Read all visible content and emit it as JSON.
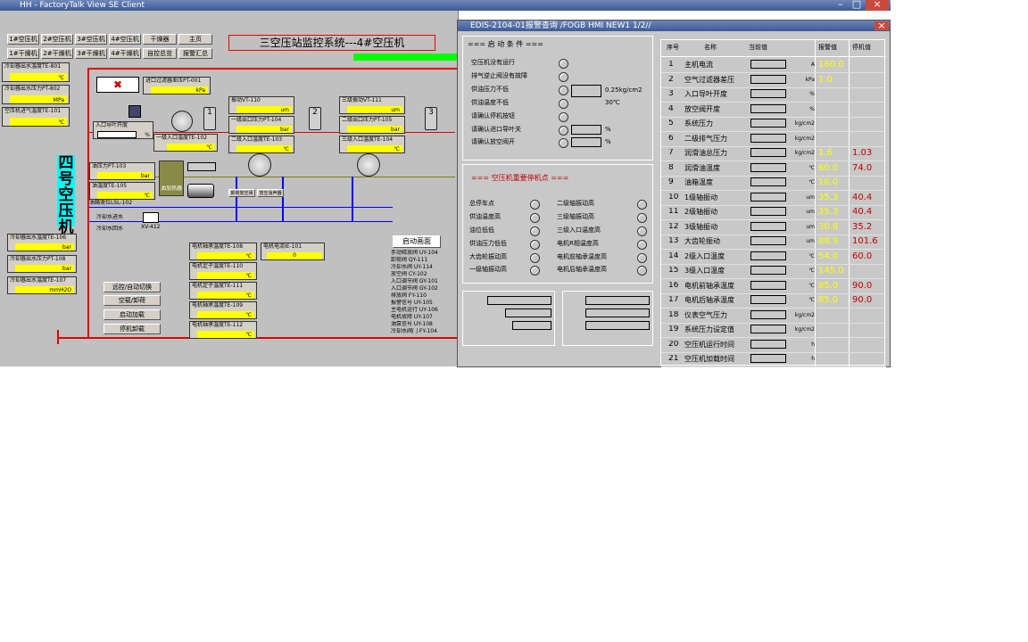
{
  "window": {
    "title": "HH - FactoryTalk View SE Client"
  },
  "scada": {
    "title": "三空压站监控系统---4#空压机",
    "nav_buttons_row1": [
      "1#空压机",
      "2#空压机",
      "3#空压机",
      "4#空压机",
      "干燥器",
      "主页"
    ],
    "nav_buttons_row2": [
      "1#干燥机",
      "2#干燥机",
      "3#干燥机",
      "4#干燥机",
      "自控总览",
      "报警汇总"
    ],
    "left_tags": [
      {
        "label": "冷却器出水温度TE-801",
        "unit": "℃"
      },
      {
        "label": "冷却器出水压力PT-802",
        "unit": "MPa"
      },
      {
        "label": "空压机进气温度TE-101",
        "unit": "℃"
      }
    ],
    "vertical_label": "四号空压机",
    "inlet_filter_label": "进口过滤器差压PT-001",
    "inlet_filter_unit": "kPa",
    "inlet_valve_label": "入口导叶开度",
    "inlet_valve_unit": "%",
    "stage_labels": [
      "1",
      "2",
      "3"
    ],
    "stage1_inlet_temp": {
      "label": "一级入口温度TE-102",
      "unit": "℃"
    },
    "block2": {
      "vib": {
        "label": "振动VT-110",
        "unit": "um"
      },
      "pressure": {
        "label": "一级出口压力PT-104",
        "unit": "bar"
      },
      "temp": {
        "label": "二级入口温度TE-103",
        "unit": "℃"
      }
    },
    "block3": {
      "vib": {
        "label": "三级振动VT-111",
        "unit": "um"
      },
      "pressure": {
        "label": "二级出口压力PT-105",
        "unit": "bar"
      },
      "temp": {
        "label": "三级入口温度TE-104",
        "unit": "℃"
      }
    },
    "oil": {
      "pressure_label": "油压力PT-103",
      "pressure_unit": "bar",
      "temp_label": "油温度TE-105",
      "temp_unit": "℃",
      "level_label": "油箱液位LSL-102",
      "heater_label": "油加热器"
    },
    "pipe_labels": [
      "卸荷放空阀",
      "放空消声器"
    ],
    "valve_tag": "XV-412",
    "small_tags": [
      "冷却水进水",
      "冷却水回水"
    ],
    "left_bottom_tags": [
      {
        "label": "冷却器出水温度TE-106",
        "unit": "bar"
      },
      {
        "label": "冷却器出水压力PT-108",
        "unit": "bar"
      },
      {
        "label": "冷却器出水温度TE-107",
        "unit": "mmH2O"
      }
    ],
    "control_buttons": [
      "远控/自动切换",
      "空载/卸荷",
      "启动加载",
      "停机卸载"
    ],
    "bearing_tags": [
      {
        "label": "电机轴承温度TE-108",
        "unit": "℃"
      },
      {
        "label": "电机定子温度TE-110",
        "unit": "℃"
      },
      {
        "label": "电机定子温度TE-111",
        "unit": "℃"
      },
      {
        "label": "电机轴承温度TE-109",
        "unit": "℃"
      },
      {
        "label": "电机轴承温度TE-112",
        "unit": "℃"
      }
    ],
    "motor_current": {
      "label": "电机电流IE-101",
      "value": "0"
    },
    "start_conditions_button": "启动画面",
    "event_list": [
      "手动释放阀 UY-104",
      "卸荷阀 QY-111",
      "冷却水阀 UY-114",
      "放空阀 CY-102",
      "入口调节阀 GY-101",
      "入口调节阀 GY-102",
      "排放阀 FY-110",
      "报警信号 UY-105",
      "主电机运行 UY-106",
      "电机故障 UY-107",
      "油泵信号 UY-108",
      "冷却水阀门 FY-104"
    ]
  },
  "popup": {
    "title": "EDIS-2104-01报警查询  /FOGB HMI NEW1 1/2//",
    "section1_title": "=== 启 动 条 件 ===",
    "start_conditions": [
      {
        "label": "空压机没有运行",
        "extra": ""
      },
      {
        "label": "排气逆止阀没有故障",
        "extra": ""
      },
      {
        "label": "供油压力不低",
        "extra": "0.25kg/cm2"
      },
      {
        "label": "供油温度不低",
        "extra": "30℃"
      },
      {
        "label": "请确认停机按钮",
        "extra": ""
      },
      {
        "label": "请确认进口导叶关",
        "extra": "%"
      },
      {
        "label": "请确认放空阀开",
        "extra": "%"
      }
    ],
    "section2_title": "=== 空压机重要停机点 ===",
    "trip_left": [
      "总停车点",
      "供油温度高",
      "油位低低",
      "供油压力低低",
      "大齿轮振动高",
      "一级轴振动高"
    ],
    "trip_right": [
      "二级轴振动高",
      "三级轴振动高",
      "三级入口温度高",
      "电机R相温度高",
      "电机前轴承温度高",
      "电机后轴承温度高"
    ],
    "table": {
      "headers": [
        "序号",
        "名称",
        "当前值",
        "报警值",
        "停机值"
      ],
      "rows": [
        {
          "no": "1",
          "name": "主机电流",
          "unit": "A",
          "alarm": "160.0",
          "trip": ""
        },
        {
          "no": "2",
          "name": "空气过滤器差压",
          "unit": "kPa",
          "alarm": "1.0",
          "trip": ""
        },
        {
          "no": "3",
          "name": "入口导叶开度",
          "unit": "%",
          "alarm": "",
          "trip": ""
        },
        {
          "no": "4",
          "name": "放空阀开度",
          "unit": "%",
          "alarm": "",
          "trip": ""
        },
        {
          "no": "5",
          "name": "系统压力",
          "unit": "kg/cm2",
          "alarm": "",
          "trip": ""
        },
        {
          "no": "6",
          "name": "二级排气压力",
          "unit": "kg/cm2",
          "alarm": "",
          "trip": ""
        },
        {
          "no": "7",
          "name": "润滑油总压力",
          "unit": "kg/cm2",
          "alarm": "1.6",
          "trip": "1.03"
        },
        {
          "no": "8",
          "name": "润滑油温度",
          "unit": "℃",
          "alarm": "60.0",
          "trip": "74.0"
        },
        {
          "no": "9",
          "name": "油箱温度",
          "unit": "℃",
          "alarm": "16.0",
          "trip": ""
        },
        {
          "no": "10",
          "name": "1级轴振动",
          "unit": "um",
          "alarm": "35.3",
          "trip": "40.4"
        },
        {
          "no": "11",
          "name": "2级轴振动",
          "unit": "um",
          "alarm": "35.3",
          "trip": "40.4"
        },
        {
          "no": "12",
          "name": "3级轴振动",
          "unit": "um",
          "alarm": "30.8",
          "trip": "35.2"
        },
        {
          "no": "13",
          "name": "大齿轮振动",
          "unit": "um",
          "alarm": "88.9",
          "trip": "101.6"
        },
        {
          "no": "14",
          "name": "2级入口温度",
          "unit": "℃",
          "alarm": "54.0",
          "trip": "60.0"
        },
        {
          "no": "15",
          "name": "3级入口温度",
          "unit": "℃",
          "alarm": "145.0",
          "trip": ""
        },
        {
          "no": "16",
          "name": "电机前轴承温度",
          "unit": "℃",
          "alarm": "85.0",
          "trip": "90.0"
        },
        {
          "no": "17",
          "name": "电机后轴承温度",
          "unit": "℃",
          "alarm": "85.0",
          "trip": "90.0"
        },
        {
          "no": "18",
          "name": "仪表空气压力",
          "unit": "kg/cm2",
          "alarm": "",
          "trip": ""
        },
        {
          "no": "19",
          "name": "系统压力设定值",
          "unit": "kg/cm2",
          "alarm": "",
          "trip": ""
        },
        {
          "no": "20",
          "name": "空压机运行时间",
          "unit": "h",
          "alarm": "",
          "trip": ""
        },
        {
          "no": "21",
          "name": "空压机加载时间",
          "unit": "h",
          "alarm": "",
          "trip": ""
        }
      ]
    }
  }
}
